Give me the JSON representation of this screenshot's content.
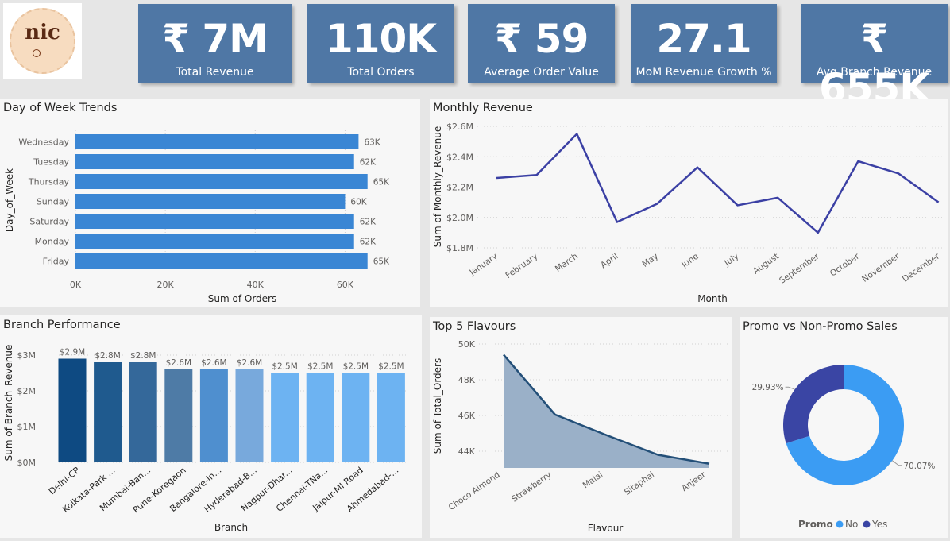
{
  "kpis": [
    {
      "value": "₹ 7M",
      "label": "Total Revenue"
    },
    {
      "value": "110K",
      "label": "Total Orders"
    },
    {
      "value": "₹ 59",
      "label": "Average Order Value"
    },
    {
      "value": "27.1",
      "label": "MoM Revenue Growth %"
    },
    {
      "value": "₹ 655K",
      "label": "Avg Branch Revenue"
    }
  ],
  "logo": {
    "text": "nic"
  },
  "panels": {
    "day_of_week": "Day of Week Trends",
    "monthly_revenue": "Monthly Revenue",
    "branch": "Branch Performance",
    "flavours": "Top 5 Flavours",
    "promo": "Promo vs Non-Promo Sales"
  },
  "chart_data": [
    {
      "type": "bar",
      "orientation": "horizontal",
      "categories": [
        "Wednesday",
        "Tuesday",
        "Thursday",
        "Sunday",
        "Saturday",
        "Monday",
        "Friday"
      ],
      "values": [
        63,
        62,
        65,
        60,
        62,
        62,
        65
      ],
      "value_labels": [
        "63K",
        "62K",
        "65K",
        "60K",
        "62K",
        "62K",
        "65K"
      ],
      "xlabel": "Sum of Orders",
      "ylabel": "Day_of_Week",
      "xticks": [
        "0K",
        "20K",
        "40K",
        "60K"
      ],
      "xlim": [
        0,
        70
      ],
      "grid": true,
      "color": "#3a86d4"
    },
    {
      "type": "line",
      "categories": [
        "January",
        "February",
        "March",
        "April",
        "May",
        "June",
        "July",
        "August",
        "September",
        "October",
        "November",
        "December"
      ],
      "values": [
        2.26,
        2.28,
        2.55,
        1.97,
        2.09,
        2.33,
        2.08,
        2.13,
        1.9,
        2.37,
        2.29,
        2.1
      ],
      "xlabel": "Month",
      "ylabel": "Sum of Monthly_Revenue",
      "yticks": [
        "$2.6M",
        "$2.4M",
        "$2.2M",
        "$2.0M",
        "$1.8M"
      ],
      "ylim": [
        1.8,
        2.6
      ],
      "grid": true,
      "color": "#3b40a4"
    },
    {
      "type": "bar",
      "categories": [
        "Delhi-CP",
        "Kolkata-Park ...",
        "Mumbai-Ban...",
        "Pune-Koregaon",
        "Bangalore-In...",
        "Hyderabad-B...",
        "Nagpur-Dhar...",
        "Chennai-TNa...",
        "Jaipur-MI Road",
        "Ahmedabad-..."
      ],
      "values": [
        2.9,
        2.8,
        2.8,
        2.6,
        2.6,
        2.6,
        2.5,
        2.5,
        2.5,
        2.5
      ],
      "value_labels": [
        "$2.9M",
        "$2.8M",
        "$2.8M",
        "$2.6M",
        "$2.6M",
        "$2.6M",
        "$2.5M",
        "$2.5M",
        "$2.5M",
        "$2.5M"
      ],
      "colors": [
        "#0e4a82",
        "#1f5a8e",
        "#34689a",
        "#4e7ba6",
        "#4f8fcf",
        "#78a9dc",
        "#6db3f2",
        "#6db3f2",
        "#6db3f2",
        "#6db3f2"
      ],
      "xlabel": "Branch",
      "ylabel": "Sum of Branch_Revenue",
      "yticks": [
        "$3M",
        "$2M",
        "$1M",
        "$0M"
      ],
      "ylim": [
        0,
        3
      ],
      "grid": true
    },
    {
      "type": "area",
      "categories": [
        "Choco Almond",
        "Strawberry",
        "Malai",
        "Sitaphal",
        "Anjeer"
      ],
      "values": [
        49400,
        46050,
        44900,
        43800,
        43300
      ],
      "xlabel": "Flavour",
      "ylabel": "Sum of Total_Orders",
      "yticks": [
        "50K",
        "48K",
        "46K",
        "44K"
      ],
      "ylim": [
        43000,
        50000
      ],
      "grid": true,
      "line_color": "#234f78",
      "fill_color": "#9ab0c8"
    },
    {
      "type": "pie",
      "donut": true,
      "legend_title": "Promo",
      "categories": [
        "No",
        "Yes"
      ],
      "values": [
        70.07,
        29.93
      ],
      "value_labels": [
        "70.07%",
        "29.93%"
      ],
      "colors": [
        "#3b9cf3",
        "#3a45a4"
      ],
      "legend_position": "bottom"
    }
  ]
}
